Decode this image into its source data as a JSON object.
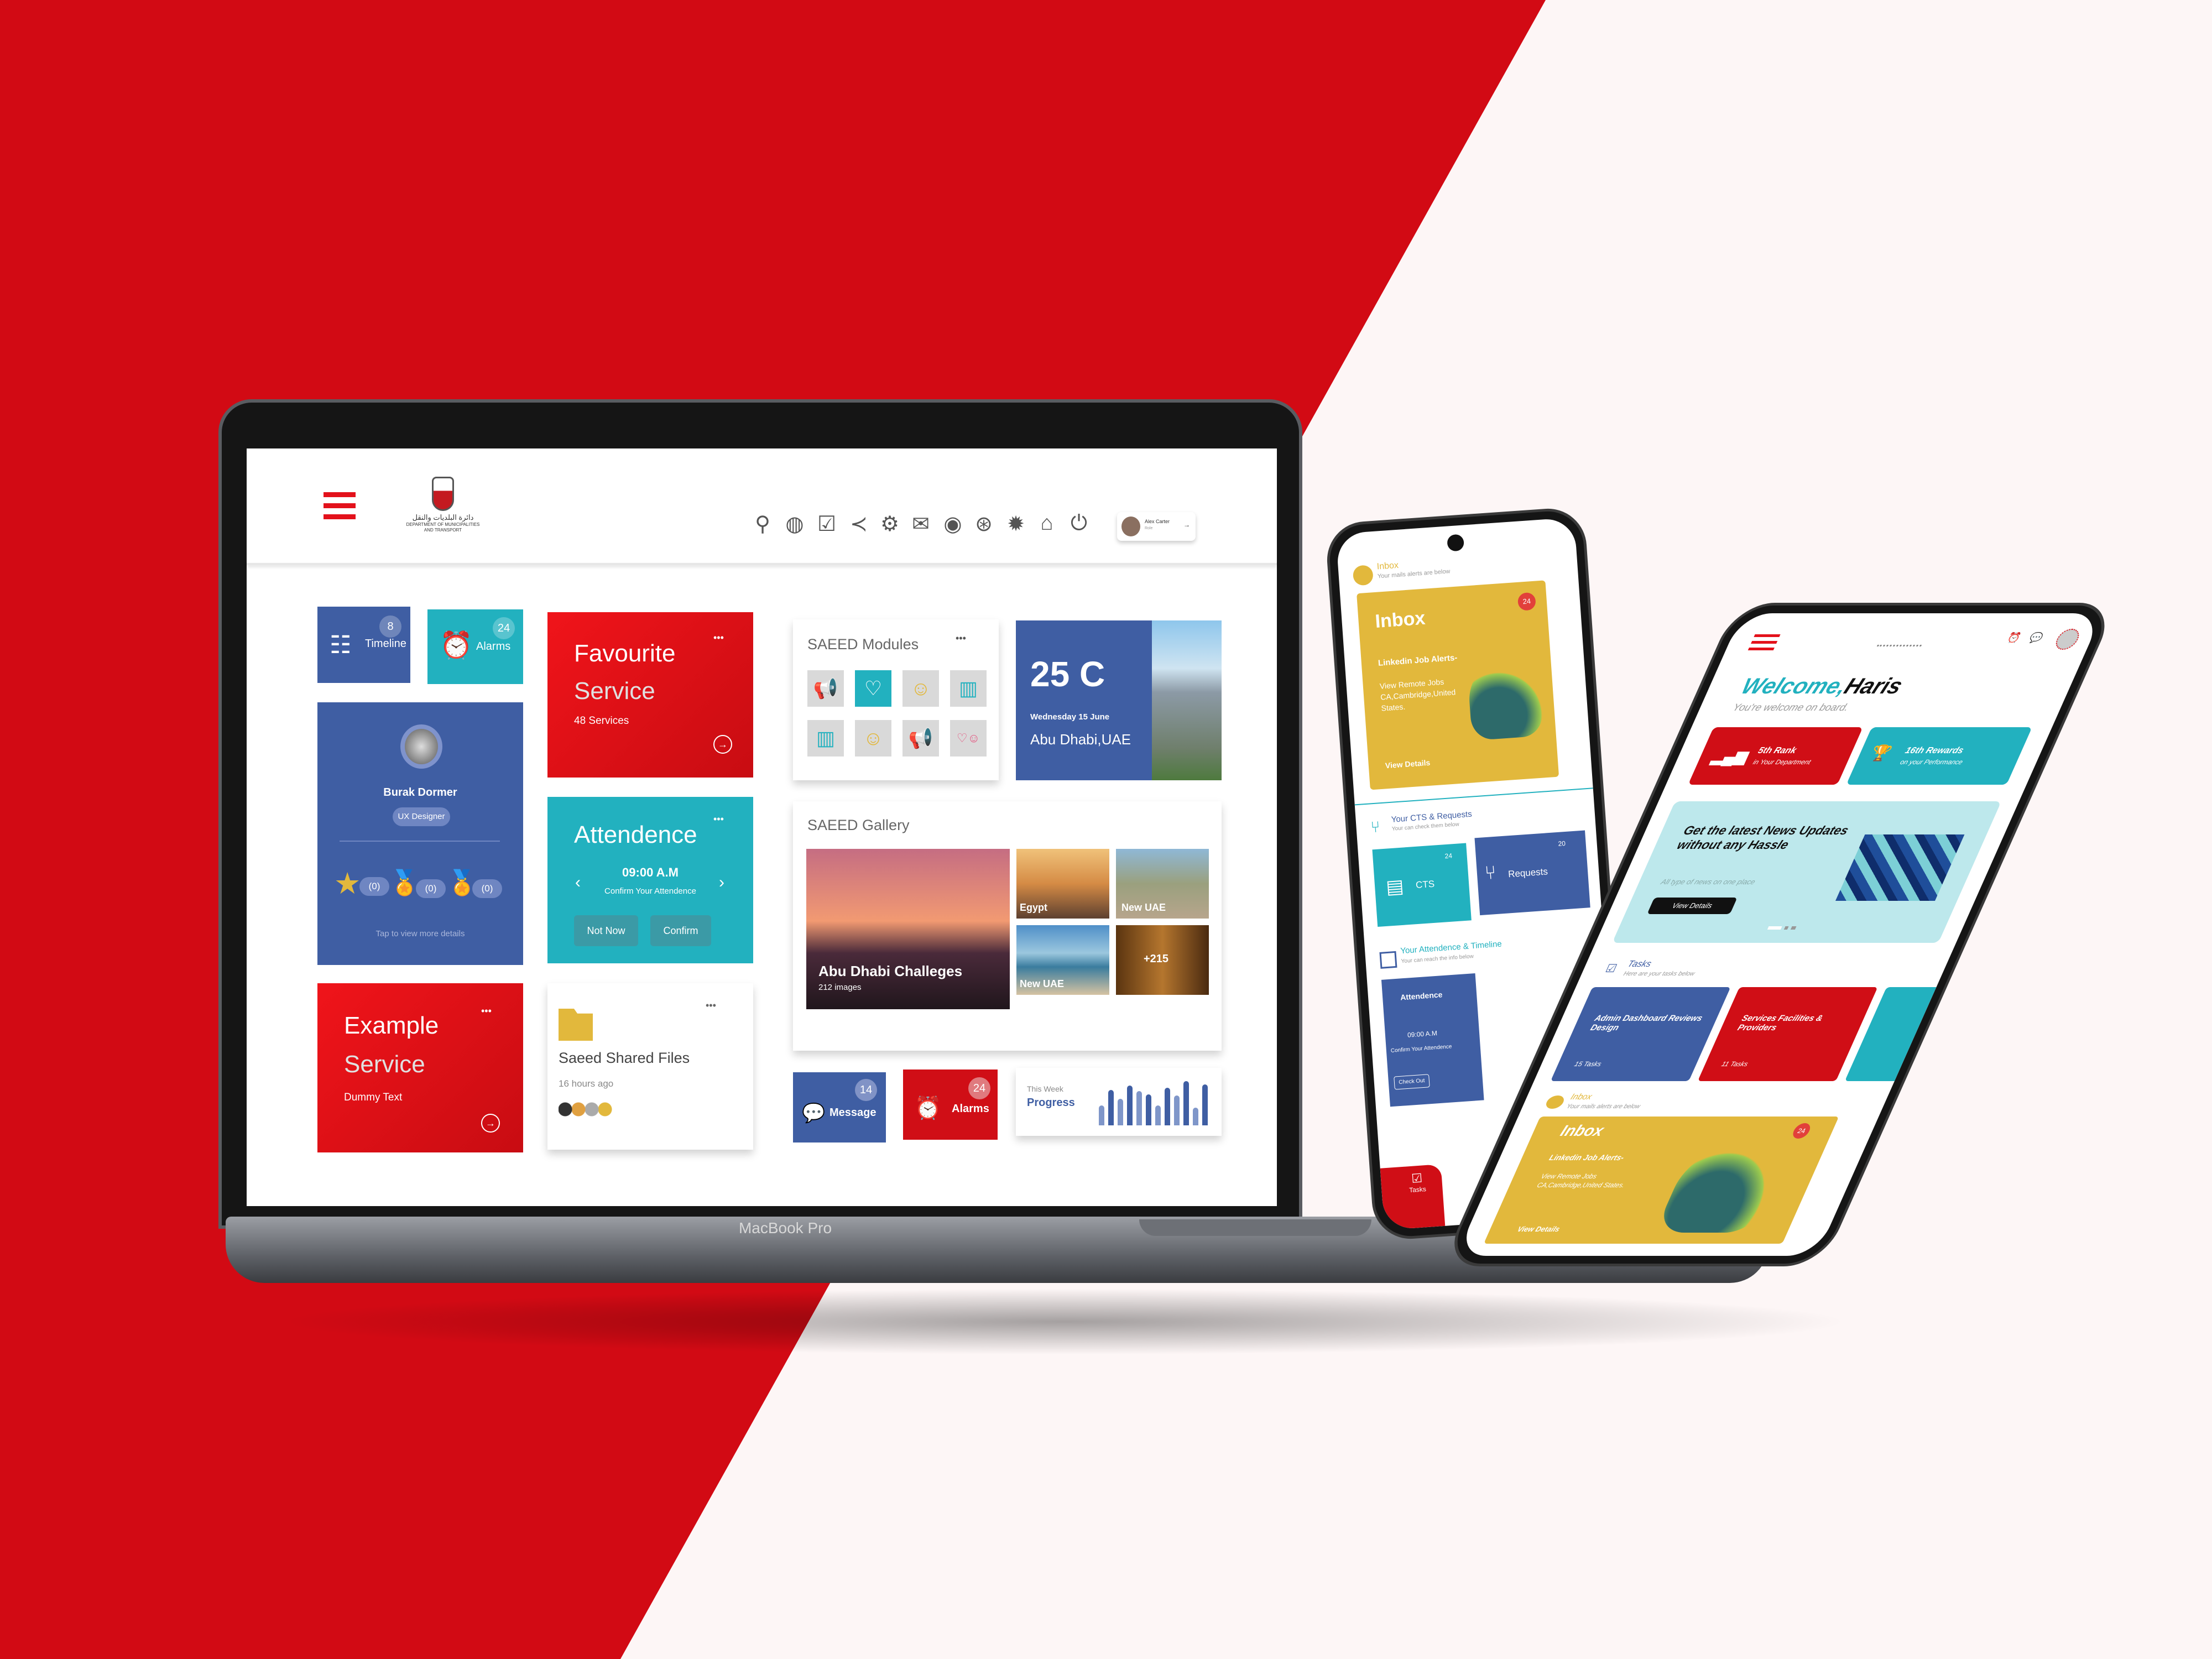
{
  "colors": {
    "brand_red": "#d20a14",
    "blue": "#3f5ea3",
    "teal": "#22b1bf",
    "yellow": "#e2b83c",
    "background": "#fdf6f6"
  },
  "laptop": {
    "label": "MacBook Pro",
    "header": {
      "menu_icon": "hamburger-icon",
      "logo_arabic": "دائرة البلديات والنقل",
      "logo_text": "DEPARTMENT OF MUNICIPALITIES AND TRANSPORT",
      "icons": [
        "search-icon",
        "globe-icon",
        "clipboard-check-icon",
        "share-icon",
        "settings-network-icon",
        "mail-check-icon",
        "eye-icon",
        "lifebuoy-icon",
        "badge-alert-icon",
        "home-heart-icon",
        "logout-icon"
      ],
      "user": {
        "name": "Alex Carter",
        "role": "Role",
        "arrow": "→"
      }
    },
    "timeline": {
      "label": "Timeline",
      "count": "8"
    },
    "alarms_small": {
      "label": "Alarms",
      "count": "24"
    },
    "profile": {
      "name": "Burak Dormer",
      "role": "UX Designer",
      "awards": [
        "(0)",
        "(0)",
        "(0)"
      ],
      "hint": "Tap to view more details"
    },
    "favourite": {
      "title_1": "Favourite",
      "title_2": "Service",
      "subtitle": "48 Services",
      "more": "•••"
    },
    "attendance": {
      "title": "Attendence",
      "time": "09:00 A.M",
      "subtitle": "Confirm Your Attendence",
      "prev": "‹",
      "next": "›",
      "not_now": "Not Now",
      "confirm": "Confirm",
      "more": "•••"
    },
    "example": {
      "title_1": "Example",
      "title_2": "Service",
      "subtitle": "Dummy Text",
      "more": "•••"
    },
    "shared_files": {
      "title": "Saeed Shared Files",
      "time": "16 hours ago",
      "more": "•••"
    },
    "modules": {
      "title": "SAEED Modules",
      "more": "•••",
      "items": [
        "megaphone-icon",
        "heart-icon",
        "smiley-icon",
        "book-icon",
        "book-icon",
        "smiley-icon",
        "megaphone-icon",
        "mixed-modules-icon"
      ]
    },
    "weather": {
      "temp": "25 C",
      "date": "Wednesday 15 June",
      "location": "Abu Dhabi,UAE"
    },
    "gallery": {
      "title": "SAEED Gallery",
      "main": {
        "title": "Abu Dhabi Challeges",
        "count": "212 images"
      },
      "thumbs": [
        "Egypt",
        "New UAE",
        "New UAE",
        "+215"
      ]
    },
    "message": {
      "label": "Message",
      "count": "14"
    },
    "alarms": {
      "label": "Alarms",
      "count": "24"
    },
    "progress": {
      "caption": "This Week",
      "label": "Progress",
      "levels": [
        0.45,
        0.8,
        0.6,
        0.9,
        0.78,
        0.7,
        0.45,
        0.85,
        0.68,
        1.0,
        0.4,
        0.92
      ]
    }
  },
  "phone_back": {
    "inbox_header": {
      "title": "Inbox",
      "subtitle": "Your mails alerts are below"
    },
    "inbox_card": {
      "title": "Inbox",
      "count": "24",
      "text_bold": "Linkedin Job Alerts-",
      "text": "View Remote Jobs CA,Cambridge,United States.",
      "cta": "View Details"
    },
    "cts_header": {
      "title": "Your CTS & Requests",
      "subtitle": "Your can check them below"
    },
    "cts": {
      "label": "CTS",
      "count": "24"
    },
    "requests": {
      "label": "Requests",
      "count": "20"
    },
    "att_header": {
      "title": "Your Attendence & Timeline",
      "subtitle": "Your can reach the info below"
    },
    "att_card": {
      "title": "Attendence",
      "time": "09:00 A.M",
      "subtitle": "Confirm Your Attendence",
      "check_out": "Check Out"
    },
    "tab": "Tasks"
  },
  "phone_front": {
    "welcome": "Welcome,",
    "name": "Haris",
    "subtitle": "You're welcome on board.",
    "rank": {
      "title": "5th Rank",
      "subtitle": "in Your Department"
    },
    "rewards": {
      "title": "16th Rewards",
      "subtitle": "on your Performance"
    },
    "news": {
      "title": "Get the latest News Updates without any Hassle",
      "subtitle": "All type of news on one place",
      "cta": "View Details"
    },
    "tasks_header": {
      "title": "Tasks",
      "subtitle": "Here are your tasks below"
    },
    "tasks": [
      {
        "title": "Admin Dashboard Reviews Design",
        "count": "15 Tasks"
      },
      {
        "title": "Services Facilities & Providers",
        "count": "11 Tasks"
      }
    ],
    "inbox_header": {
      "title": "Inbox",
      "subtitle": "Your mails alerts are below"
    },
    "inbox_card": {
      "title": "Inbox",
      "count": "24",
      "text_bold": "Linkedin Job Alerts-",
      "text": "View Remote Jobs CA,Cambridge,United States.",
      "cta": "View Details"
    }
  }
}
